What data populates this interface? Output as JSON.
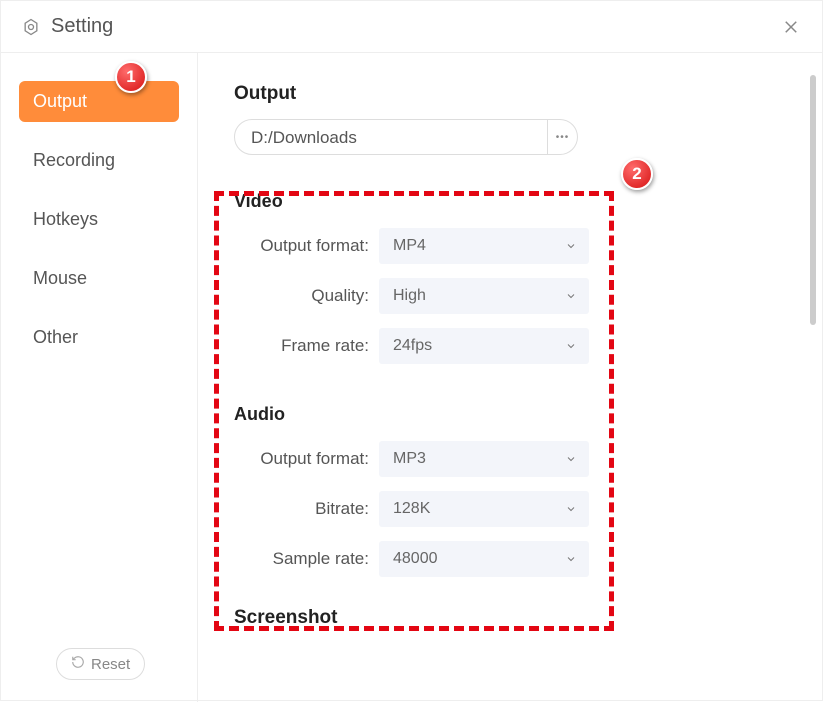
{
  "header": {
    "title": "Setting"
  },
  "sidebar": {
    "items": [
      {
        "label": "Output"
      },
      {
        "label": "Recording"
      },
      {
        "label": "Hotkeys"
      },
      {
        "label": "Mouse"
      },
      {
        "label": "Other"
      }
    ],
    "reset_label": "Reset"
  },
  "content": {
    "output_title": "Output",
    "output_path": "D:/Downloads",
    "path_btn": "•••",
    "video": {
      "title": "Video",
      "format_label": "Output format:",
      "format_value": "MP4",
      "quality_label": "Quality:",
      "quality_value": "High",
      "framerate_label": "Frame rate:",
      "framerate_value": "24fps"
    },
    "audio": {
      "title": "Audio",
      "format_label": "Output format:",
      "format_value": "MP3",
      "bitrate_label": "Bitrate:",
      "bitrate_value": "128K",
      "samplerate_label": "Sample rate:",
      "samplerate_value": "48000"
    },
    "screenshot_title": "Screenshot"
  },
  "annotations": {
    "callout1": "1",
    "callout2": "2"
  }
}
